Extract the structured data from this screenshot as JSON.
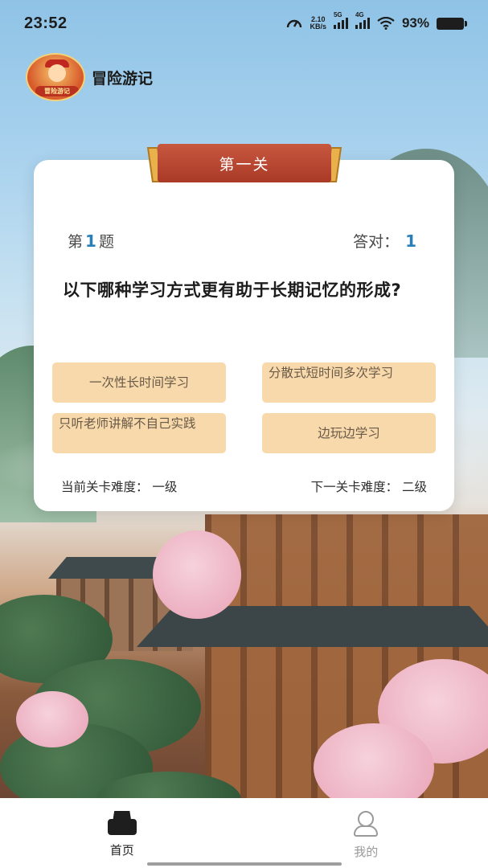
{
  "status_bar": {
    "time": "23:52",
    "net_speed_value": "2.10",
    "net_speed_unit": "KB/s",
    "signal_1_label": "5G",
    "signal_2_label": "4G",
    "battery": "93%",
    "icons": [
      "speed-gauge-icon",
      "signal-5g-icon",
      "signal-4g-icon",
      "wifi-icon",
      "battery-icon"
    ]
  },
  "app": {
    "title": "冒险游记",
    "logo_text": "冒险游记"
  },
  "quiz": {
    "level_title": "第一关",
    "question_prefix": "第",
    "question_number": "1",
    "question_suffix": "题",
    "correct_label": "答对：",
    "correct_count": "1",
    "question": "以下哪种学习方式更有助于长期记忆的形成?",
    "options": [
      "一次性长时间学习",
      "分散式短时间多次学习",
      "只听老师讲解不自己实践",
      "边玩边学习"
    ],
    "current_difficulty": "当前关卡难度：  一级",
    "next_difficulty": "下一关卡难度：  二级"
  },
  "bottom_nav": {
    "items": [
      {
        "label": "首页",
        "icon": "home-icon",
        "active": true
      },
      {
        "label": "我的",
        "icon": "user-icon",
        "active": false
      }
    ]
  },
  "colors": {
    "option_bg": "#f7d9ab",
    "ribbon": "#b8432d",
    "accent_number": "#2b7fb8"
  }
}
